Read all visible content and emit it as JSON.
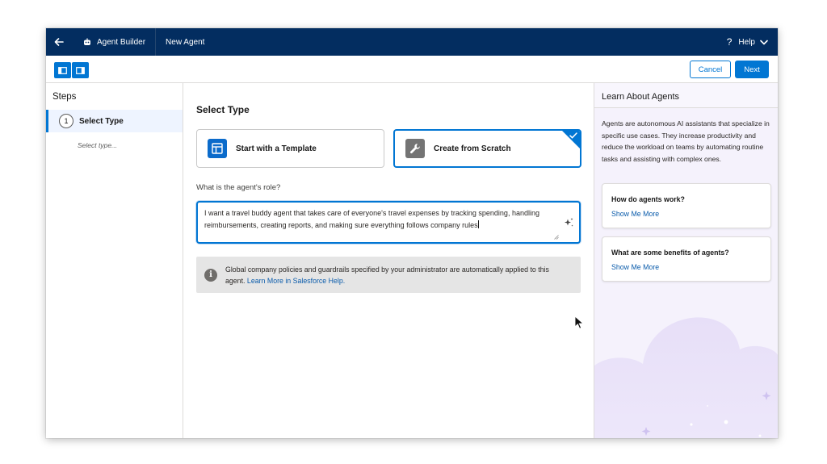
{
  "topbar": {
    "app_name": "Agent Builder",
    "page_tab": "New Agent",
    "help_label": "Help"
  },
  "toolbar": {
    "cancel_label": "Cancel",
    "next_label": "Next"
  },
  "steps": {
    "heading": "Steps",
    "items": [
      {
        "number": "1",
        "label": "Select Type",
        "sub": "Select type..."
      }
    ]
  },
  "main": {
    "title": "Select Type",
    "cards": [
      {
        "label": "Start with a Template",
        "selected": false
      },
      {
        "label": "Create from Scratch",
        "selected": true
      }
    ],
    "role_label": "What is the agent's role?",
    "role_value": "I want a travel buddy agent that takes care of everyone's travel expenses by tracking spending, handling reimbursements, creating reports, and making sure everything follows company rules",
    "notice_text": "Global company policies and guardrails specified by your administrator are automatically applied to this agent.",
    "notice_link": "Learn More in Salesforce Help."
  },
  "learn": {
    "title": "Learn About Agents",
    "description": "Agents are autonomous AI assistants that specialize in specific use cases. They increase productivity and reduce the workload on teams by automating routine tasks and assisting with complex ones.",
    "cards": [
      {
        "question": "How do agents work?",
        "link": "Show Me More"
      },
      {
        "question": "What are some benefits of agents?",
        "link": "Show Me More"
      }
    ]
  },
  "colors": {
    "nav_bg": "#032d60",
    "brand_blue": "#0176d3",
    "learn_bg": "#f5f2fc"
  }
}
